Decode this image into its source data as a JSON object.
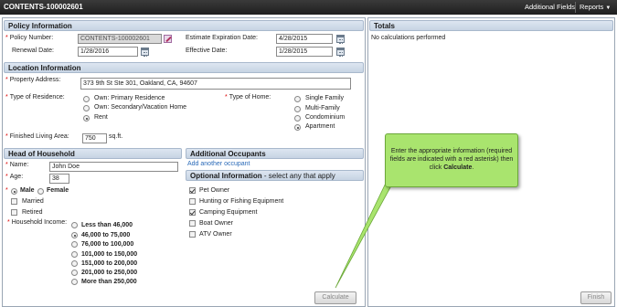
{
  "app": {
    "title": "CONTENTS-100002601",
    "menu": {
      "additional_fields": "Additional Fields",
      "reports": "Reports",
      "reports_icon": "chevron-down-icon"
    }
  },
  "policy": {
    "header": "Policy Information",
    "policy_number_label": "Policy Number:",
    "policy_number": "CONTENTS-100002601",
    "renewal_label": "Renewal Date:",
    "renewal_date": "1/28/2016",
    "est_exp_label": "Estimate Expiration Date:",
    "est_exp_date": "4/28/2015",
    "effective_label": "Effective Date:",
    "effective_date": "1/28/2015"
  },
  "location": {
    "header": "Location Information",
    "address_label": "Property Address:",
    "address": "373 9th St Ste 301, Oakland, CA, 94607",
    "residence_label": "Type of Residence:",
    "residence_options": [
      "Own: Primary Residence",
      "Own: Secondary/Vacation Home",
      "Rent"
    ],
    "residence_selected": "Rent",
    "home_label": "Type of Home:",
    "home_options": [
      "Single Family",
      "Multi-Family",
      "Condominium",
      "Apartment"
    ],
    "home_selected": "Apartment",
    "living_area_label": "Finished Living Area:",
    "living_area": "750",
    "living_area_unit": "sq.ft."
  },
  "household": {
    "header": "Head of Household",
    "name_label": "Name:",
    "name": "John Doe",
    "age_label": "Age:",
    "age": "38",
    "gender_options": [
      "Male",
      "Female"
    ],
    "gender_selected": "Male",
    "married_label": "Married",
    "retired_label": "Retired",
    "income_label": "Household Income:",
    "income_options": [
      "Less than 46,000",
      "46,000 to 75,000",
      "76,000 to 100,000",
      "101,000 to 150,000",
      "151,000 to 200,000",
      "201,000 to 250,000",
      "More than 250,000"
    ],
    "income_selected": "46,000 to 75,000"
  },
  "occupants": {
    "header": "Additional Occupants",
    "add_link": "Add another occupant"
  },
  "optional": {
    "header": "Optional Information",
    "header_suffix": " - select any that apply",
    "items": [
      {
        "label": "Pet Owner",
        "checked": true
      },
      {
        "label": "Hunting or Fishing Equipment",
        "checked": false
      },
      {
        "label": "Camping Equipment",
        "checked": true
      },
      {
        "label": "Boat Owner",
        "checked": false
      },
      {
        "label": "ATV Owner",
        "checked": false
      }
    ]
  },
  "totals": {
    "header": "Totals",
    "empty_text": "No calculations performed"
  },
  "buttons": {
    "calculate": "Calculate",
    "finish": "Finish"
  },
  "callout": {
    "text": "Enter the appropriate information (required fields are indicated with a red asterisk) then click ",
    "emphasis": "Calculate",
    "end": "."
  },
  "colors": {
    "topbar": "#2b2b2b",
    "section_header": "#c6d3e3",
    "callout": "#a9e46e",
    "required": "#dd0000"
  }
}
